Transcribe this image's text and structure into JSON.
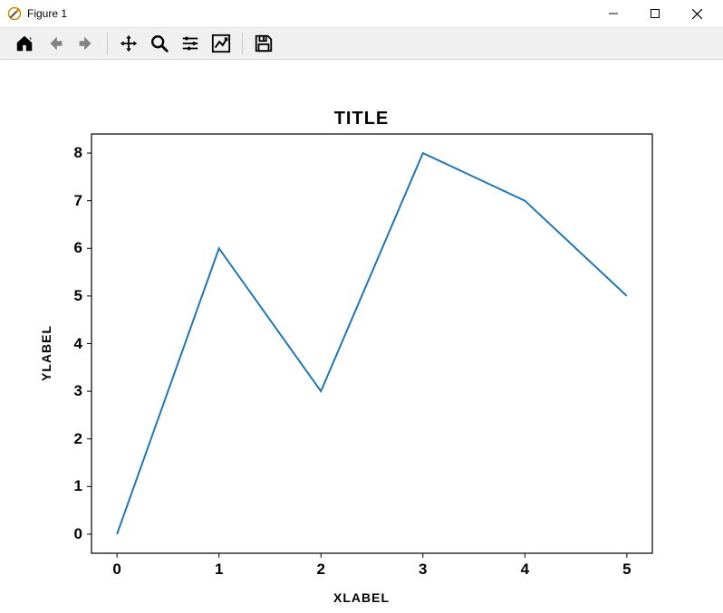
{
  "window": {
    "title": "Figure 1"
  },
  "toolbar": {
    "icons": [
      "home",
      "back",
      "forward",
      "pan",
      "zoom",
      "configure",
      "edit",
      "save"
    ]
  },
  "chart_data": {
    "type": "line",
    "title": "TITLE",
    "xlabel": "XLABEL",
    "ylabel": "YLABEL",
    "x": [
      0,
      1,
      2,
      3,
      4,
      5
    ],
    "values": [
      0,
      6,
      3,
      8,
      7,
      5
    ],
    "xticks": [
      0,
      1,
      2,
      3,
      4,
      5
    ],
    "yticks": [
      0,
      1,
      2,
      3,
      4,
      5,
      6,
      7,
      8
    ],
    "xlim": [
      -0.25,
      5.25
    ],
    "ylim": [
      -0.4,
      8.4
    ],
    "line_color": "#1f77b4"
  }
}
